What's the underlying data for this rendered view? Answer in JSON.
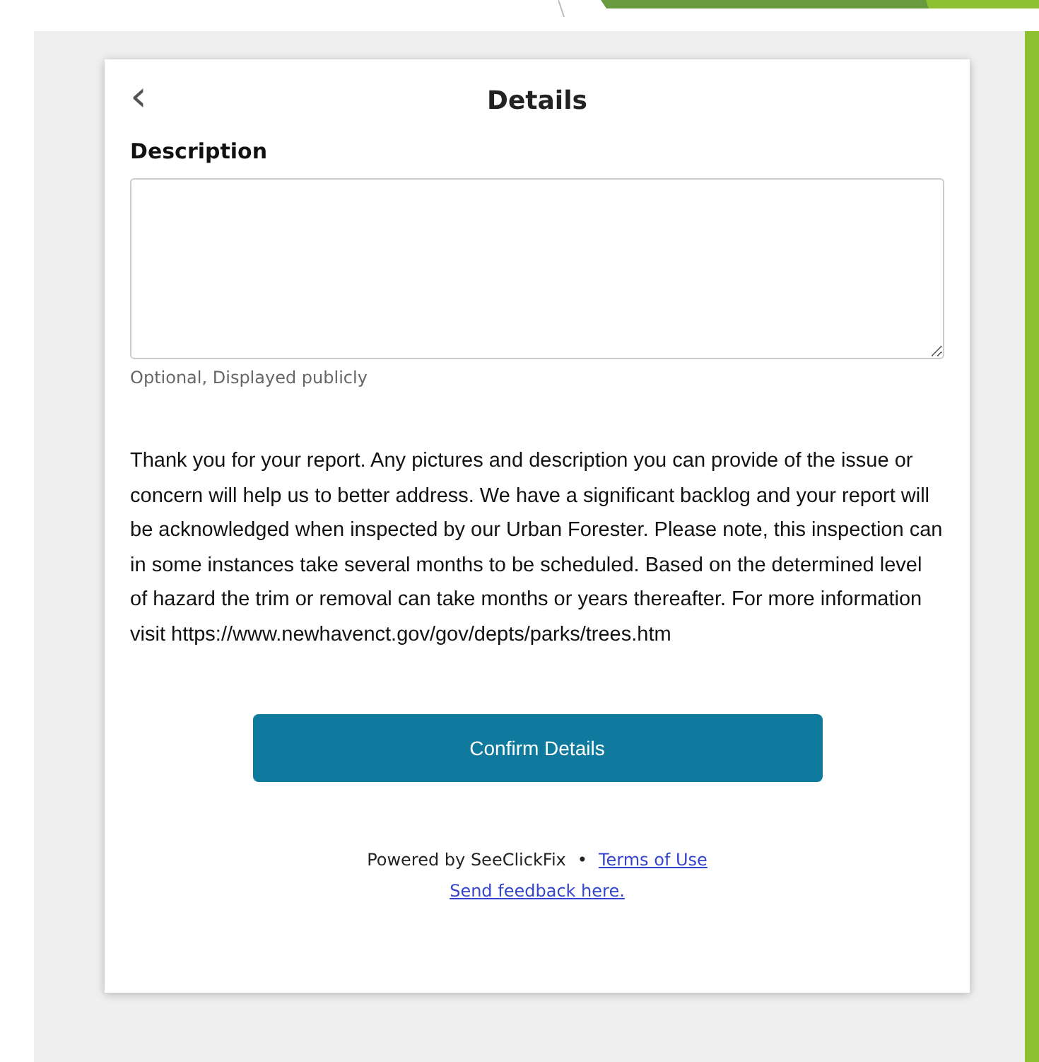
{
  "header": {
    "back_icon": "‹",
    "title": "Details"
  },
  "description": {
    "label": "Description",
    "helper": "Optional, Displayed publicly"
  },
  "message": "Thank you for your report. Any pictures and description you can provide of the issue or concern will help us to better address. We have a significant backlog and your report will be acknowledged when inspected by our Urban Forester. Please note, this inspection can in some instances take several months to be scheduled. Based on the determined level of hazard the trim or removal can take months or years thereafter. For more information visit https://www.newhavenct.gov/gov/depts/parks/trees.htm",
  "confirm_button": "Confirm Details",
  "footer": {
    "powered_by": "Powered by SeeClickFix",
    "separator": "•",
    "terms_link": "Terms of Use",
    "feedback_link": "Send feedback here."
  }
}
